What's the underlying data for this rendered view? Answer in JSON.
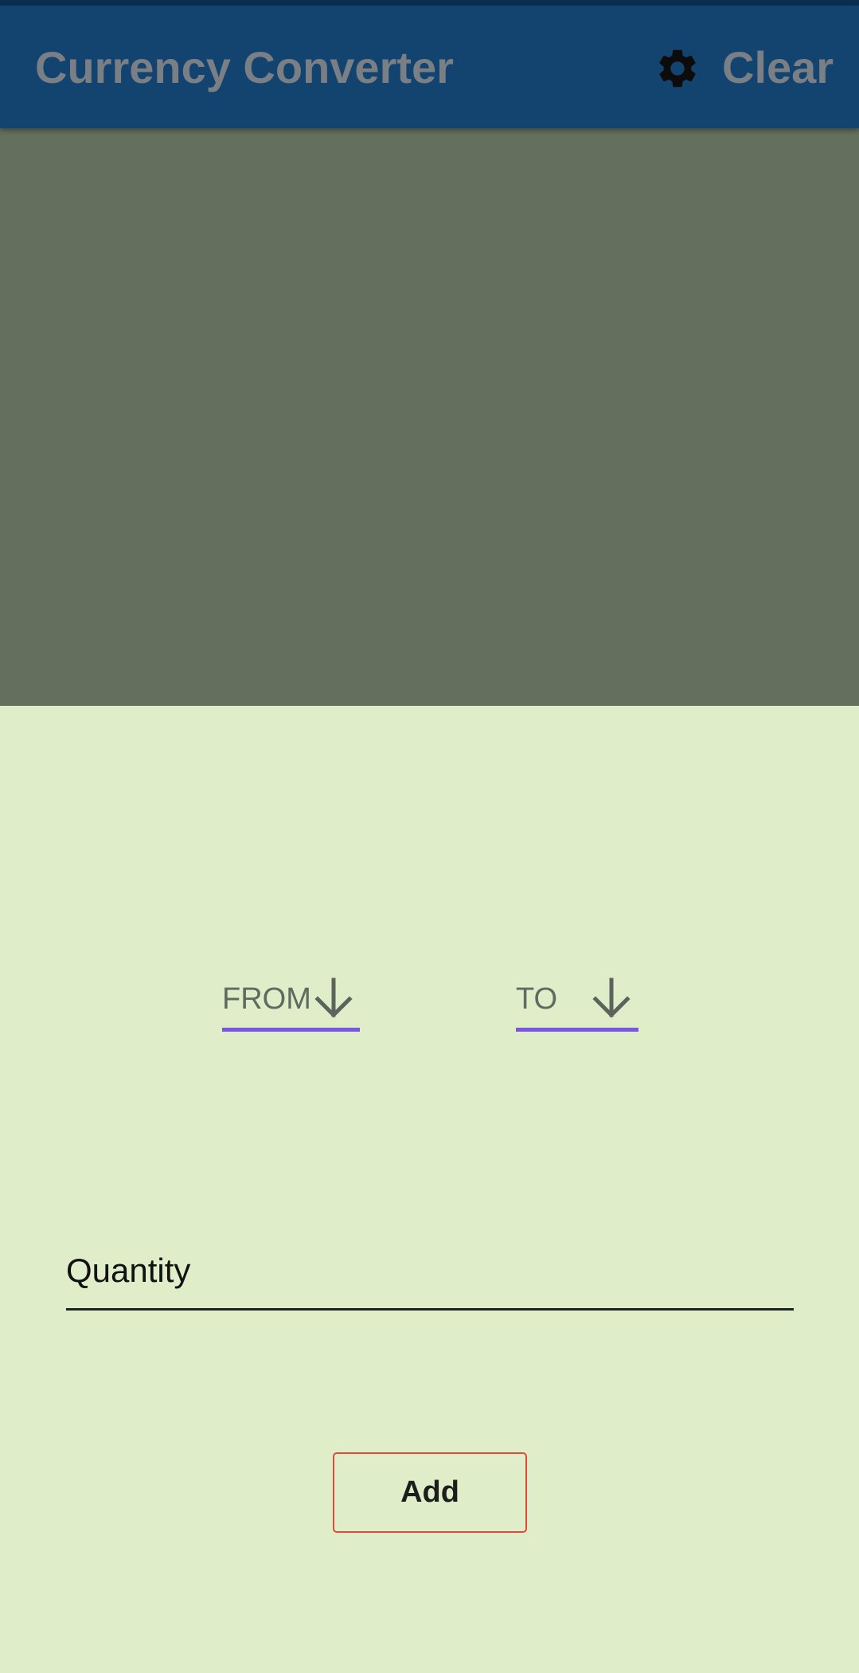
{
  "app_bar": {
    "title": "Currency Converter",
    "settings_icon": "gear-icon",
    "clear_label": "Clear",
    "background_color": "#12446f",
    "text_color": "#7a7f86"
  },
  "chart_area": {
    "background_color": "#656f5d"
  },
  "spinners": {
    "from": {
      "label": "FROM",
      "icon": "arrow-down-icon"
    },
    "to": {
      "label": "TO",
      "icon": "arrow-down-icon"
    },
    "underline_color": "#7a56e0"
  },
  "quantity": {
    "placeholder": "Quantity",
    "value": ""
  },
  "add_button": {
    "label": "Add",
    "border_color": "#e04a3a"
  },
  "colors": {
    "page_background": "#dfedc9",
    "status_bar": "#0a2f4e"
  }
}
